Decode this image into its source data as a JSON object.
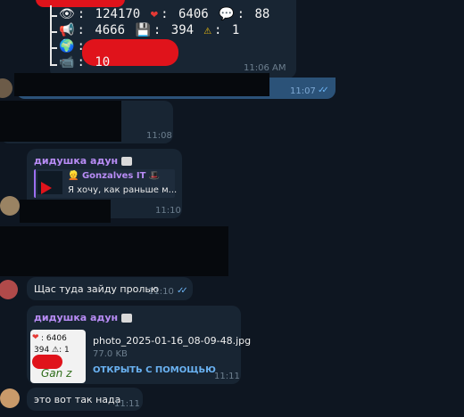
{
  "stats": {
    "views": "124170",
    "likes": "6406",
    "comments": "88",
    "reposts": "4666",
    "saves": "394",
    "warnings": "1",
    "videos": "10",
    "time": "11:06 AM"
  },
  "messages": {
    "m1_time": "11:07",
    "m2_time": "11:08",
    "reply_sender": "дидушка адун",
    "reply_to_name": "Gonzalves IT",
    "reply_to_text": "Я хочу, как раньше м...",
    "reply_time": "11:10",
    "out_text": "Щас туда зайду пролью",
    "out_time": "11:10",
    "file_sender": "дидушка адун",
    "file_name": "photo_2025-01-16_08-09-48.jpg",
    "file_size": "77.0 KB",
    "file_action": "ОТКРЫТЬ С ПОМОЩЬЮ",
    "file_time": "11:11",
    "last_text": "это вот так нада",
    "last_time": "11:11"
  },
  "thumb": {
    "likes": "6406",
    "saves": "394",
    "warnings": "1",
    "scribble": "Gan z"
  },
  "colors": {
    "background": "#0e1621",
    "incoming": "#182533",
    "outgoing": "#2b5278",
    "accent": "#6ab2f2",
    "sender": "#b88cf5"
  }
}
